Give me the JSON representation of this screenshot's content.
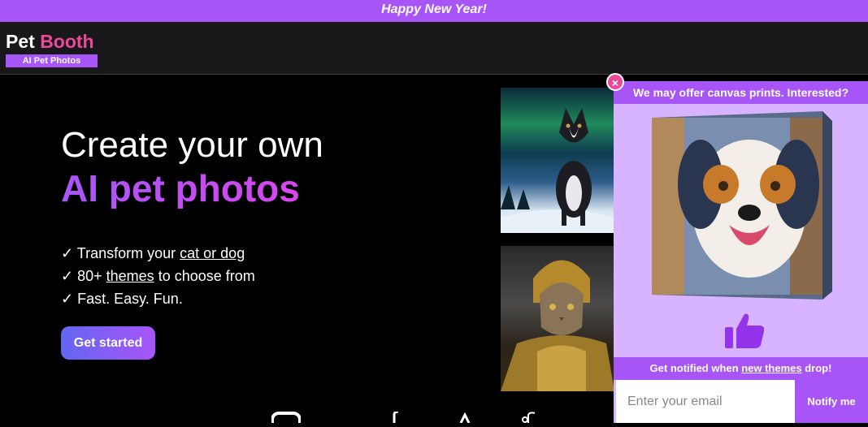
{
  "banner": {
    "text": "Happy New Year!"
  },
  "header": {
    "logo_pet": "Pet ",
    "logo_booth": "Booth",
    "logo_sub": "AI Pet Photos"
  },
  "hero": {
    "title_line1": "Create your own",
    "title_line2": "AI pet photos",
    "features": [
      {
        "check": "✓",
        "prefix": "Transform your ",
        "link": "cat or dog",
        "suffix": ""
      },
      {
        "check": "✓",
        "prefix": "80+ ",
        "link": "themes",
        "suffix": " to choose from"
      },
      {
        "check": "✓",
        "prefix": "Fast. Easy. Fun.",
        "link": "",
        "suffix": ""
      }
    ],
    "cta_label": "Get started"
  },
  "popup": {
    "heading": "We may offer canvas prints. Interested?",
    "close_glyph": "×",
    "notify_prefix": "Get notified when ",
    "notify_link": "new themes",
    "notify_suffix": " drop!",
    "email_placeholder": "Enter your email",
    "notify_button": "Notify me"
  },
  "colors": {
    "accent": "#a855f7",
    "pink": "#ec4899",
    "popup_bg": "#d8b4fe"
  }
}
